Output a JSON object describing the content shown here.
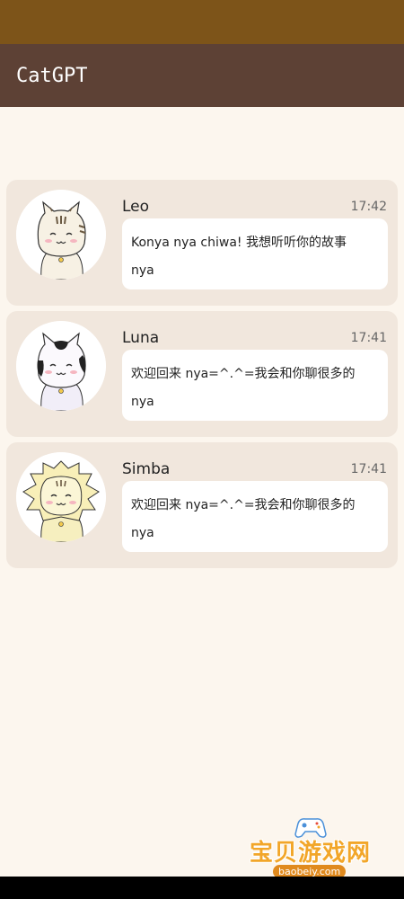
{
  "app": {
    "title": "CatGPT"
  },
  "chats": [
    {
      "name": "Leo",
      "time": "17:42",
      "message_line1": "Konya nya chiwa! 我想听听你的故事",
      "message_line2": "nya",
      "avatar_icon": "tabby-cat-avatar-icon"
    },
    {
      "name": "Luna",
      "time": "17:41",
      "message_line1": "欢迎回来 nya=^.^=我会和你聊很多的",
      "message_line2": "nya",
      "avatar_icon": "calico-cat-avatar-icon"
    },
    {
      "name": "Simba",
      "time": "17:41",
      "message_line1": "欢迎回来 nya=^.^=我会和你聊很多的",
      "message_line2": "nya",
      "avatar_icon": "lion-cat-avatar-icon"
    }
  ],
  "watermark": {
    "text": "宝贝游戏网",
    "url": "baobeiy.com"
  },
  "colors": {
    "status_bar": "#7d5419",
    "app_bar": "#5d4135",
    "background": "#fcf6ee",
    "card": "#f1e7dd",
    "bubble": "#ffffff"
  }
}
